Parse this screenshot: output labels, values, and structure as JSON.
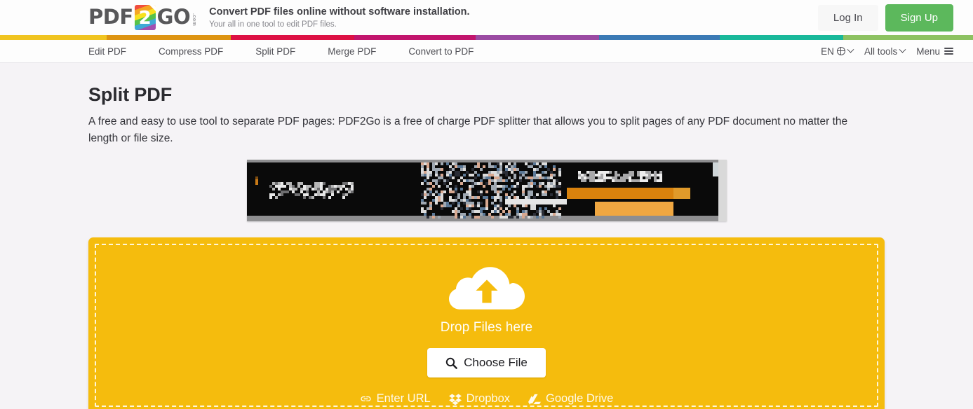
{
  "header": {
    "logo": {
      "part1": "PDF",
      "badge": "2",
      "part2": "GO",
      "suffix": ".com"
    },
    "tagline_main": "Convert PDF files online without software installation.",
    "tagline_sub": "Your all in one tool to edit PDF files.",
    "login_label": "Log In",
    "signup_label": "Sign Up",
    "signup_color": "#5cb85c"
  },
  "colorbar": [
    {
      "color": "#f0c420",
      "width": 12.6
    },
    {
      "color": "#dd9412",
      "width": 14.7
    },
    {
      "color": "#dd1144",
      "width": 14.6
    },
    {
      "color": "#c2156d",
      "width": 14.3
    },
    {
      "color": "#9b4ba3",
      "width": 14.6
    },
    {
      "color": "#3b7ab5",
      "width": 14.3
    },
    {
      "color": "#18b89a",
      "width": 14.6
    },
    {
      "color": "#8dc262",
      "width": 15.3
    }
  ],
  "nav": {
    "items": [
      {
        "label": "Edit PDF"
      },
      {
        "label": "Compress PDF"
      },
      {
        "label": "Split PDF"
      },
      {
        "label": "Merge PDF"
      },
      {
        "label": "Convert to PDF"
      }
    ],
    "language": "EN",
    "all_tools": "All tools",
    "menu": "Menu"
  },
  "main": {
    "title": "Split PDF",
    "description": "A free and easy to use tool to separate PDF pages: PDF2Go is a free of charge PDF splitter that allows you to split pages of any PDF document no matter the length or file size."
  },
  "banner": {
    "alt": "pixelated-advertisement-banner"
  },
  "dropzone": {
    "background": "#f5bc0d",
    "drop_label": "Drop Files here",
    "choose_file_label": "Choose File",
    "sources": [
      {
        "label": "Enter URL",
        "icon": "link-icon"
      },
      {
        "label": "Dropbox",
        "icon": "dropbox-icon"
      },
      {
        "label": "Google Drive",
        "icon": "google-drive-icon"
      }
    ]
  }
}
